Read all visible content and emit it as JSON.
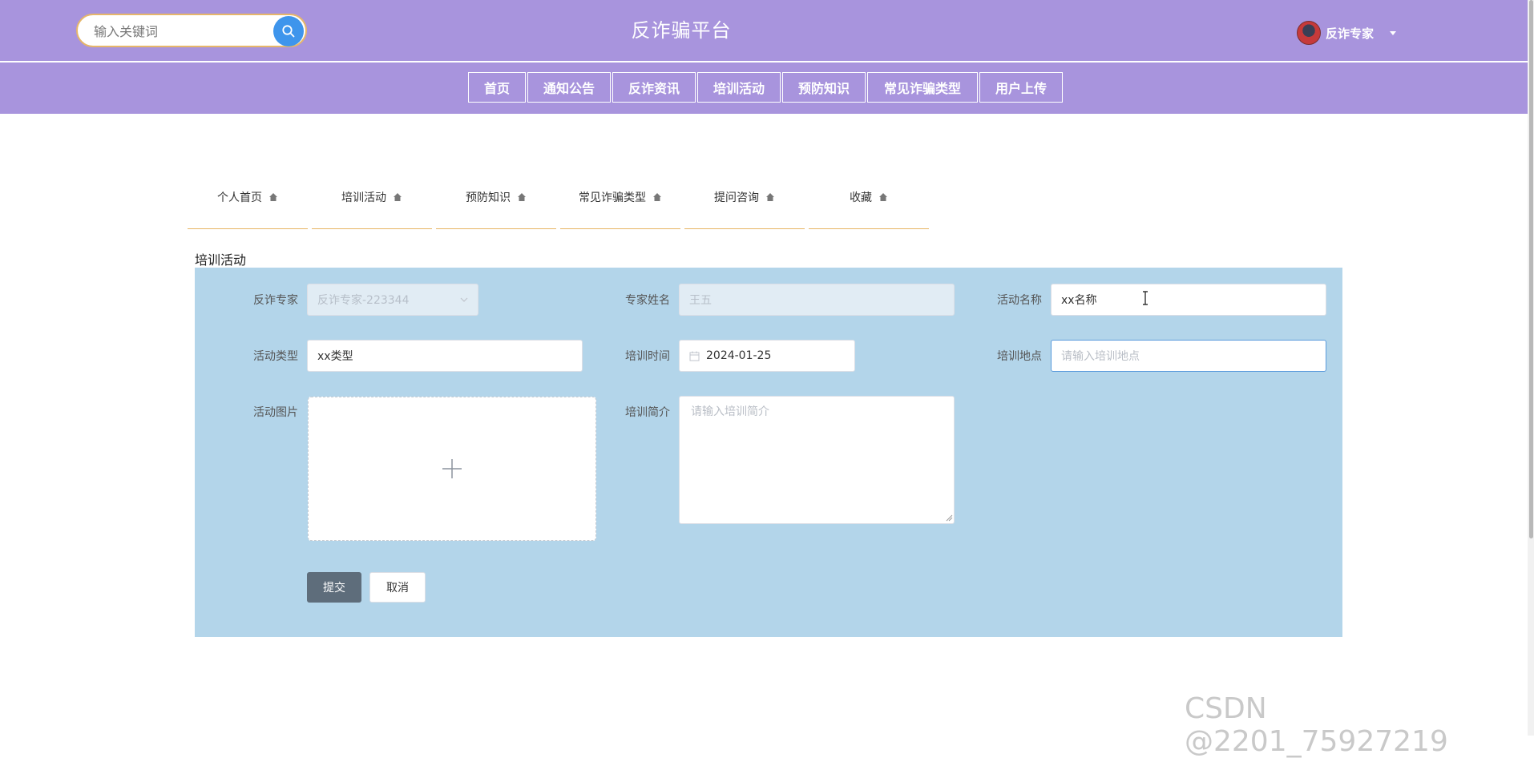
{
  "header": {
    "search_placeholder": "输入关键词",
    "site_title": "反诈骗平台",
    "user_name": "反诈专家"
  },
  "nav": {
    "items": [
      "首页",
      "通知公告",
      "反诈资讯",
      "培训活动",
      "预防知识",
      "常见诈骗类型",
      "用户上传"
    ]
  },
  "subtabs": {
    "items": [
      "个人首页",
      "培训活动",
      "预防知识",
      "常见诈骗类型",
      "提问咨询",
      "收藏"
    ]
  },
  "section_title": "培训活动",
  "form": {
    "expert_label": "反诈专家",
    "expert_value": "反诈专家-223344",
    "expert_name_label": "专家姓名",
    "expert_name_value": "王五",
    "activity_name_label": "活动名称",
    "activity_name_value": "xx名称",
    "activity_type_label": "活动类型",
    "activity_type_value": "xx类型",
    "training_time_label": "培训时间",
    "training_time_value": "2024-01-25",
    "training_place_label": "培训地点",
    "training_place_placeholder": "请输入培训地点",
    "activity_image_label": "活动图片",
    "training_intro_label": "培训简介",
    "training_intro_placeholder": "请输入培训简介",
    "submit_label": "提交",
    "cancel_label": "取消"
  },
  "watermark": "CSDN @2201_75927219",
  "colors": {
    "header_bg": "#a894dd",
    "panel_bg": "#b3d5ea",
    "search_btn": "#3e95ec",
    "submit_btn": "#5e6d7b",
    "tab_underline": "#e7b563"
  }
}
